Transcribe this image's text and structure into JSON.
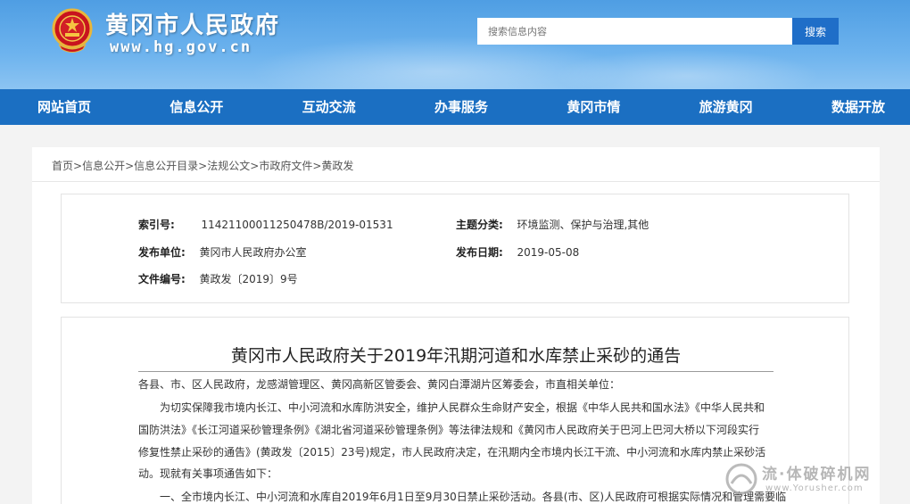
{
  "header": {
    "site_title": "黄冈市人民政府",
    "site_url": "www.hg.gov.cn",
    "search_placeholder": "搜索信息内容",
    "search_button": "搜索"
  },
  "nav": {
    "items": [
      "网站首页",
      "信息公开",
      "互动交流",
      "办事服务",
      "黄冈市情",
      "旅游黄冈",
      "数据开放"
    ]
  },
  "breadcrumb": {
    "items": [
      "首页",
      "信息公开",
      "信息公开目录",
      "法规公文",
      "市政府文件",
      "黄政发"
    ],
    "separator": ">"
  },
  "meta": {
    "index_label": "索引号:",
    "index_value": "11421100011250478B/2019-01531",
    "category_label": "主题分类:",
    "category_value": "环境监测、保护与治理,其他",
    "publisher_label": "发布单位:",
    "publisher_value": "黄冈市人民政府办公室",
    "date_label": "发布日期:",
    "date_value": "2019-05-08",
    "docno_label": "文件编号:",
    "docno_value": "黄政发〔2019〕9号"
  },
  "document": {
    "title": "黄冈市人民政府关于2019年汛期河道和水库禁止采砂的通告",
    "lines": [
      "各县、市、区人民政府，龙感湖管理区、黄冈高新区管委会、黄冈白潭湖片区筹委会，市直相关单位：",
      "　　为切实保障我市境内长江、中小河流和水库防洪安全，维护人民群众生命财产安全，根据《中华人民共和国水法》《中华人民共和",
      "国防洪法》《长江河道采砂管理条例》《湖北省河道采砂管理条例》等法律法规和《黄冈市人民政府关于巴河上巴河大桥以下河段实行",
      "修复性禁止采砂的通告》(黄政发〔2015〕23号)规定，市人民政府决定，在汛期内全市境内长江干流、中小河流和水库内禁止采砂活",
      "动。现就有关事项通告如下：",
      "　　一、全市境内长江、中小河流和水库自2019年6月1日至9月30日禁止采砂活动。各县(市、区)人民政府可根据实际情况和管理需要临"
    ]
  },
  "watermark": {
    "text": "流·体破碎机网",
    "url": "www.Yorusher.com"
  },
  "colors": {
    "header_blue": "#5aa8ea",
    "nav_blue": "#1b6fc2",
    "search_button": "#1f6ec8"
  }
}
